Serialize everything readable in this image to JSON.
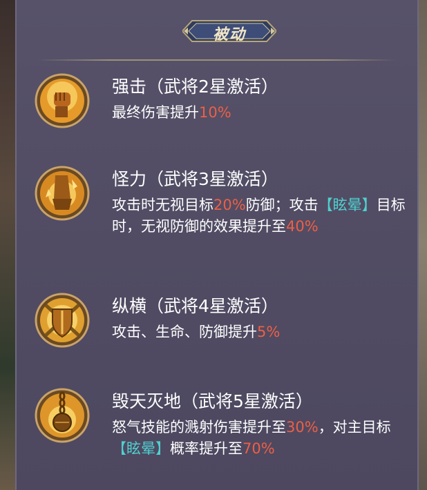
{
  "header": {
    "title": "被动"
  },
  "skills": [
    {
      "icon": "fist-icon",
      "name": "强击（武将2星激活）",
      "desc": [
        "最终伤害提升",
        "10%"
      ]
    },
    {
      "icon": "gauntlet-icon",
      "name": "怪力（武将3星激活）",
      "desc": [
        "攻击时无视目标",
        "20%",
        "防御；攻击",
        "【眩晕】",
        "目标时，无视防御的效果提升至",
        "40%"
      ]
    },
    {
      "icon": "shield-swords-icon",
      "name": "纵横（武将4星激活）",
      "desc": [
        "攻击、生命、防御提升",
        "5%"
      ]
    },
    {
      "icon": "chain-flail-icon",
      "name": "毁天灭地（武将5星激活）",
      "desc": [
        "怒气技能的溅射伤害提升至",
        "30%",
        "，对主目标",
        "【眩晕】",
        "概率提升至",
        "70%"
      ]
    }
  ],
  "colors": {
    "highlight": "#ee5f45",
    "keyword": "#4fd0cf",
    "panel": "#534e66"
  }
}
